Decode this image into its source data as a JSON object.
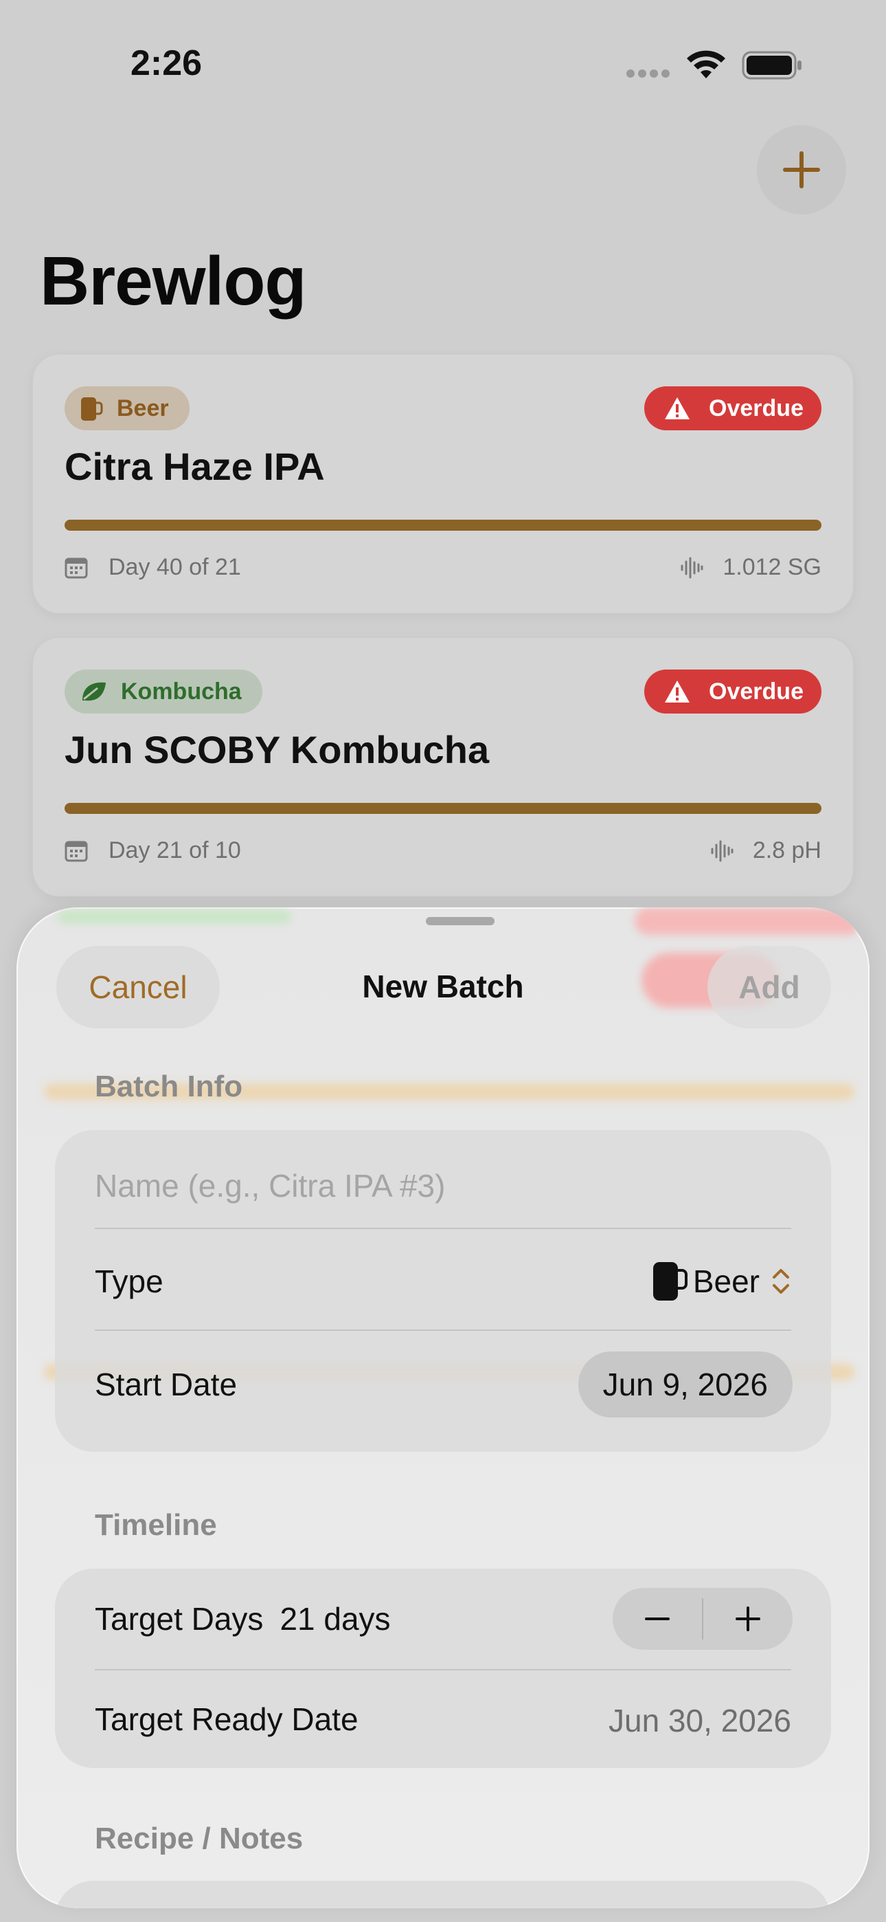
{
  "status_bar": {
    "time": "2:26"
  },
  "header": {
    "title": "Brewlog",
    "add_icon": "plus-icon"
  },
  "batches": [
    {
      "type_label": "Beer",
      "type_icon": "mug-icon",
      "status": "Overdue",
      "name": "Citra Haze IPA",
      "progress_fraction": 1.0,
      "day_text": "Day 40 of 21",
      "reading": "1.012 SG"
    },
    {
      "type_label": "Kombucha",
      "type_icon": "leaf-icon",
      "status": "Overdue",
      "name": "Jun SCOBY Kombucha",
      "progress_fraction": 1.0,
      "day_text": "Day 21 of 10",
      "reading": "2.8 pH"
    }
  ],
  "sheet": {
    "cancel_label": "Cancel",
    "title": "New Batch",
    "add_label": "Add",
    "batch_info": {
      "header": "Batch Info",
      "name_placeholder": "Name (e.g., Citra IPA #3)",
      "type_label": "Type",
      "type_value": "Beer",
      "start_date_label": "Start Date",
      "start_date_value": "Jun 9, 2026"
    },
    "timeline": {
      "header": "Timeline",
      "target_days_label": "Target Days",
      "target_days_value": "21 days",
      "target_ready_label": "Target Ready Date",
      "target_ready_value": "Jun 30, 2026"
    },
    "notes": {
      "header": "Recipe / Notes"
    }
  },
  "colors": {
    "accent": "#a06b26",
    "overdue": "#d53a3a",
    "progress": "#8a6327"
  }
}
